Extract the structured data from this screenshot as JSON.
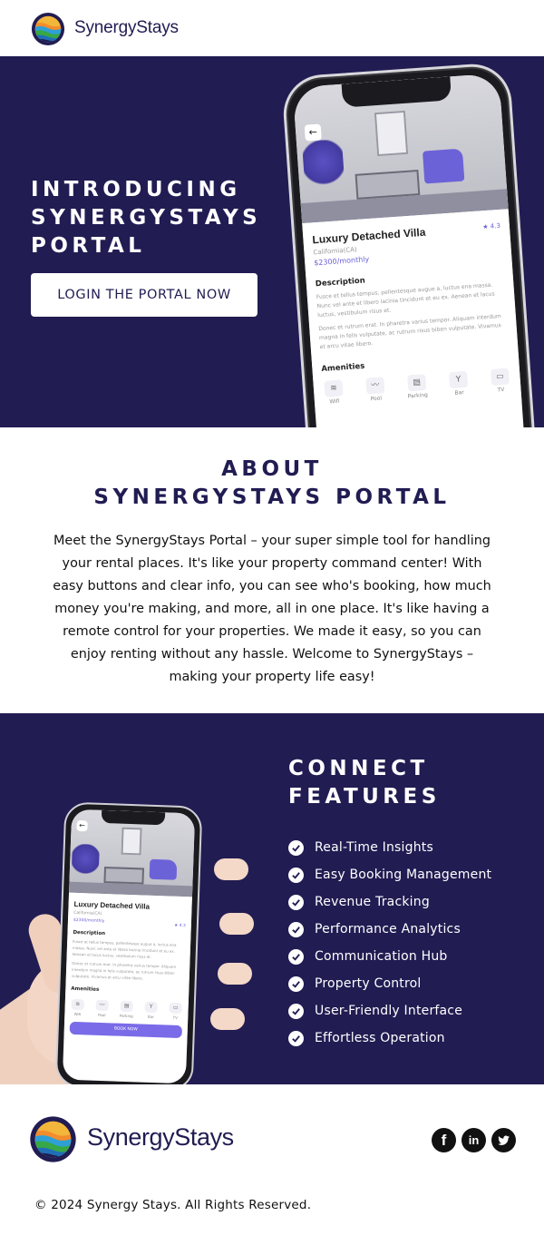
{
  "header": {
    "brand": "SynergyStays"
  },
  "hero": {
    "title_lines": [
      "INTRODUCING",
      "SYNERGYSTAYS",
      "PORTAL"
    ],
    "cta_label": "LOGIN THE PORTAL NOW"
  },
  "mockup": {
    "listing_title": "Luxury Detached Villa",
    "location": "California(CA)",
    "price": "$2300",
    "price_unit": "/monthly",
    "rating": "4.3",
    "description_heading": "Description",
    "description_p1": "Fusce et tellus tempus, pellentesque augue a, luctus ena massa. Nunc vel ante et libero lacinia tincidunt et eu ex. Aenean et lacus luctus, vestibulum risus et.",
    "description_p2": "Donec et rutrum erat. In pharetra varius tempor. Aliquam interdum magna in felis vulputate, ac rutrum risus biben vulputate. Vivamus et arcu vitae libero.",
    "amenities_heading": "Amenities",
    "amenities": [
      "Wifi",
      "Pool",
      "Parking",
      "Bar",
      "TV"
    ],
    "book_label": "BOOK NOW"
  },
  "about": {
    "title_lines": [
      "ABOUT",
      "SYNERGYSTAYS PORTAL"
    ],
    "body": "Meet the SynergyStays Portal – your super simple tool for handling your rental places. It's like your property command center! With easy buttons and clear info, you can see who's booking, how much money you're making, and more, all in one place. It's like having a remote control for your properties. We made it easy, so you can enjoy renting without any hassle. Welcome to SynergyStays – making your property life easy!"
  },
  "features": {
    "title_lines": [
      "CONNECT",
      "FEATURES"
    ],
    "items": [
      "Real-Time Insights",
      "Easy Booking Management",
      "Revenue Tracking",
      "Performance Analytics",
      "Communication Hub",
      "Property Control",
      "User-Friendly Interface",
      "Effortless Operation"
    ]
  },
  "footer": {
    "brand": "SynergyStays",
    "social": [
      "facebook-icon",
      "linkedin-icon",
      "twitter-icon"
    ],
    "copyright": "© 2024 Synergy Stays. All Rights Reserved."
  },
  "colors": {
    "navy": "#211c52",
    "accent": "#7a6be8"
  }
}
